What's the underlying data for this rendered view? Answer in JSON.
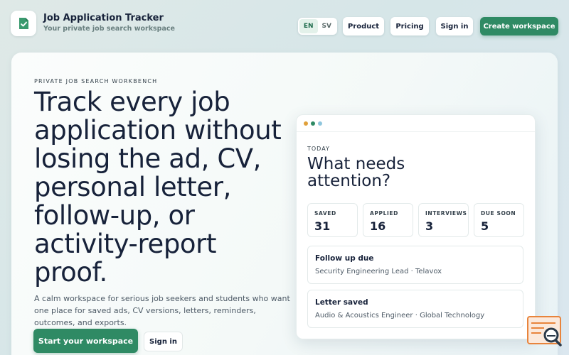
{
  "header": {
    "brand_title": "Job Application Tracker",
    "brand_subtitle": "Your private job search workspace",
    "languages": [
      "EN",
      "SV"
    ],
    "active_language": "EN",
    "nav": {
      "product": "Product",
      "pricing": "Pricing",
      "sign_in": "Sign in",
      "create_workspace": "Create workspace"
    }
  },
  "hero": {
    "eyebrow": "PRIVATE JOB SEARCH WORKBENCH",
    "headline": "Track every job application without losing the ad, CV, personal letter, follow-up, or activity-report proof.",
    "lead": "A calm workspace for serious job seekers and students who want one place for saved ads, CV versions, letters, reminders, outcomes, and exports.",
    "primary_cta": "Start your workspace",
    "secondary_cta": "Sign in"
  },
  "dashboard": {
    "label": "TODAY",
    "title": "What needs attention?",
    "stats": [
      {
        "label": "SAVED",
        "value": "31"
      },
      {
        "label": "APPLIED",
        "value": "16"
      },
      {
        "label": "INTERVIEWS",
        "value": "3"
      },
      {
        "label": "DUE SOON",
        "value": "5"
      }
    ],
    "tasks": [
      {
        "title": "Follow up due",
        "subtitle": "Security Engineering Lead · Telavox"
      },
      {
        "title": "Letter saved",
        "subtitle": "Audio & Acoustics Engineer · Global Technology"
      }
    ]
  },
  "colors": {
    "accent": "#2f8a64",
    "text": "#17223a",
    "dot_orange": "#e0a03a",
    "dot_green": "#2f8a64",
    "dot_blue": "#8fc6dd",
    "widget_orange": "#e8843c"
  },
  "icons": {
    "logo": "clipboard-check-icon",
    "corner_widget": "search-assistant-icon"
  }
}
